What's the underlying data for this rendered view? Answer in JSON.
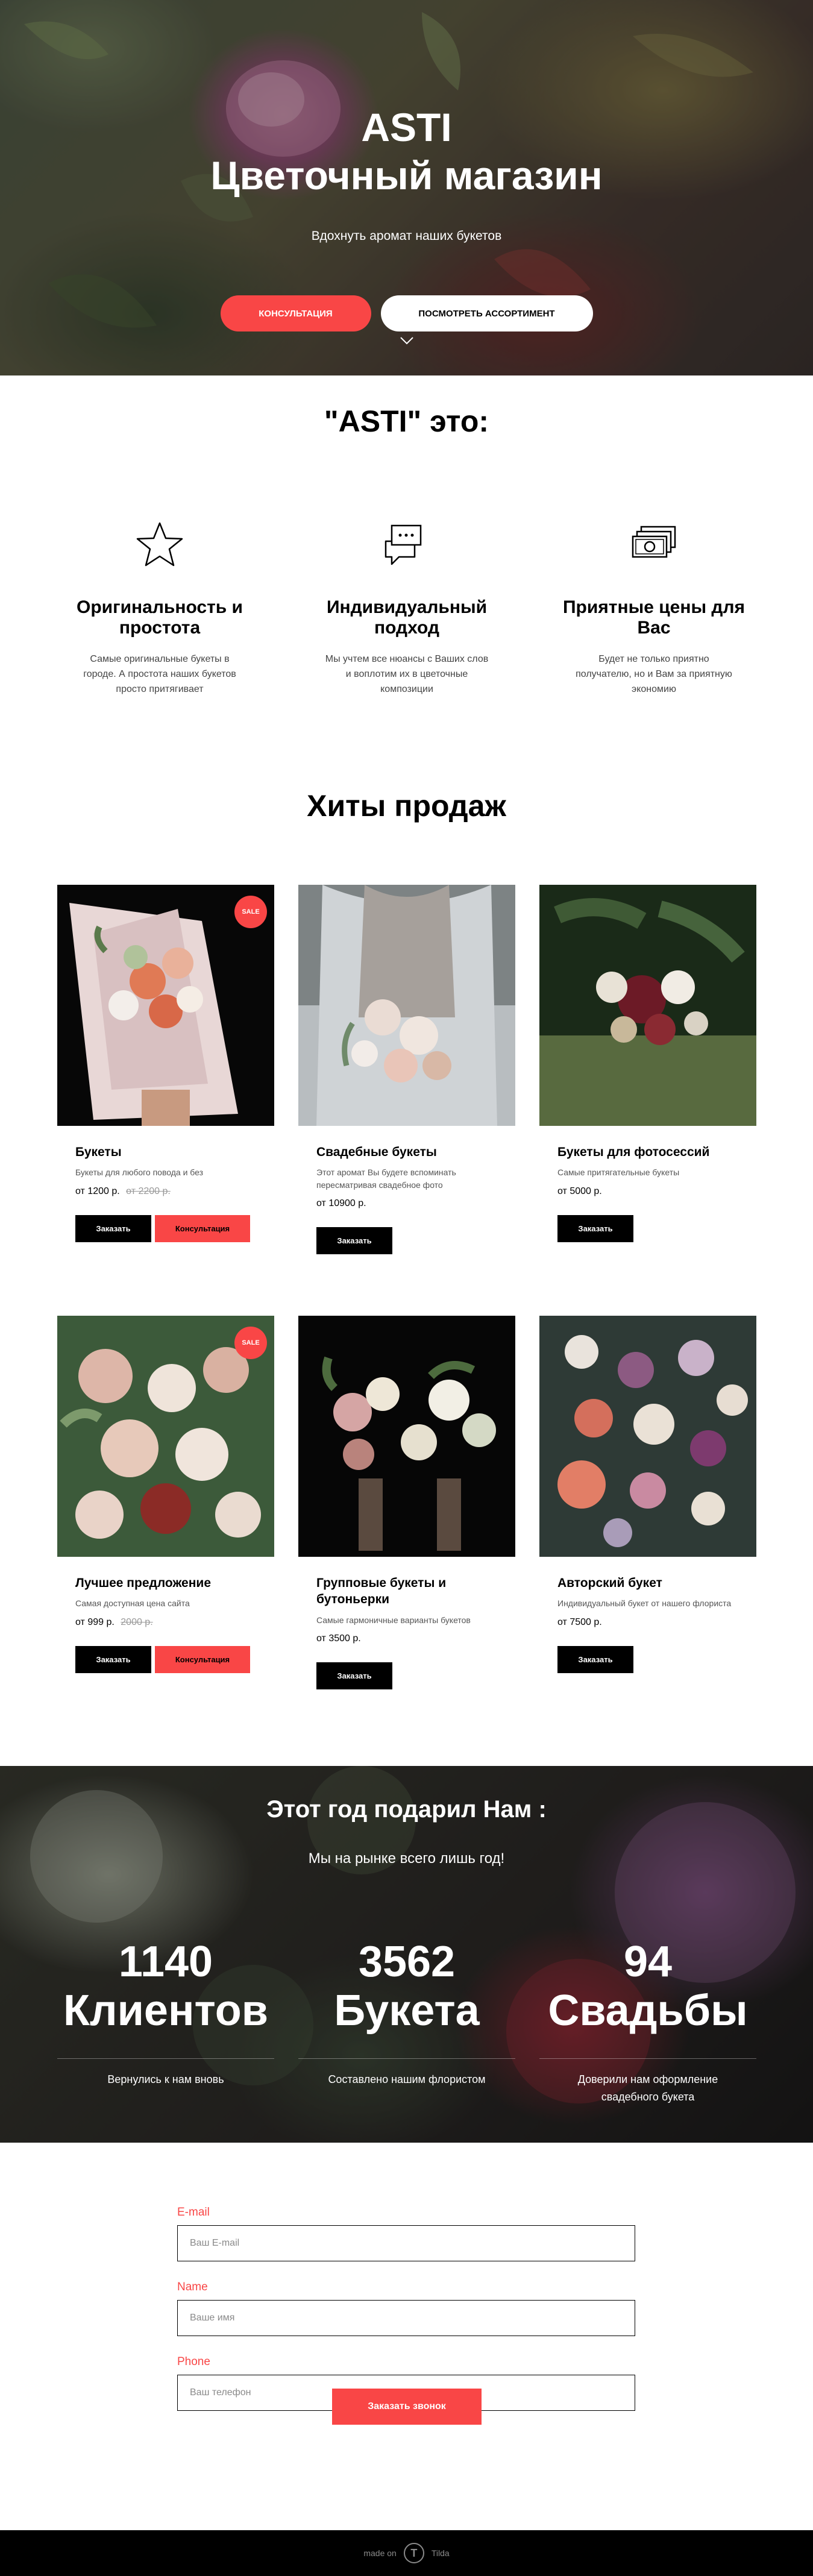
{
  "hero": {
    "title": "ASTI",
    "subtitle": "Цветочный магазин",
    "description": "Вдохнуть аромат наших букетов",
    "consult_button": "КОНСУЛЬТАЦИЯ",
    "catalog_button": "ПОСМОТРЕТЬ АССОРТИМЕНТ",
    "arrow_icon": "chevron-down-icon"
  },
  "about": {
    "title": "\"ASTI\" это:",
    "features": [
      {
        "icon": "star-icon",
        "title": "Оригинальность и простота",
        "text": "Самые оригинальные букеты в городе. А простота наших букетов просто притягивает"
      },
      {
        "icon": "chat-icon",
        "title": "Индивидуальный подход",
        "text": "Мы учтем все нюансы с Ваших слов и воплотим их в цветочные композиции"
      },
      {
        "icon": "money-icon",
        "title": "Приятные цены для Вас",
        "text": "Будет не только приятно получателю, но и Вам за приятную экономию"
      }
    ]
  },
  "products": {
    "title": "Хиты продаж",
    "sale_label": "SALE",
    "items": [
      {
        "title": "Букеты",
        "desc": "Букеты для любого повода и без",
        "price": "от 1200 р.",
        "old_price": "от 2200 р.",
        "sale": true,
        "order": "Заказать",
        "consult": "Консультация"
      },
      {
        "title": "Свадебные букеты",
        "desc": "Этот аромат Вы будете вспоминать пересматривая свадебное фото",
        "price": "от 10900 р.",
        "old_price": "",
        "sale": false,
        "order": "Заказать",
        "consult": ""
      },
      {
        "title": "Букеты для фотосессий",
        "desc": "Самые притягательные букеты",
        "price": "от 5000 р.",
        "old_price": "",
        "sale": false,
        "order": "Заказать",
        "consult": ""
      },
      {
        "title": "Лучшее предложение",
        "desc": "Самая доступная цена сайта",
        "price": "от 999 р.",
        "old_price": "2000 р.",
        "sale": true,
        "order": "Заказать",
        "consult": "Консультация"
      },
      {
        "title": "Групповые букеты и бутоньерки",
        "desc": "Самые гармоничные варианты букетов",
        "price": "от 3500 р.",
        "old_price": "",
        "sale": false,
        "order": "Заказать",
        "consult": ""
      },
      {
        "title": "Авторский букет",
        "desc": "Индивидуальный букет от нашего флориста",
        "price": "от 7500 р.",
        "old_price": "",
        "sale": false,
        "order": "Заказать",
        "consult": ""
      }
    ]
  },
  "stats": {
    "title": "Этот год подарил Нам :",
    "subtitle": "Мы на рынке всего лишь год!",
    "items": [
      {
        "number": "1140",
        "label": "Клиентов",
        "text": "Вернулись к нам вновь"
      },
      {
        "number": "3562",
        "label": "Букета",
        "text": "Составлено нашим флористом"
      },
      {
        "number": "94",
        "label": "Свадьбы",
        "text": "Доверили нам оформление свадебного букета"
      }
    ]
  },
  "form": {
    "email_label": "E-mail",
    "email_placeholder": "Ваш E-mail",
    "name_label": "Name",
    "name_placeholder": "Ваше имя",
    "phone_label": "Phone",
    "phone_placeholder": "Ваш телефон",
    "submit": "Заказать звонок"
  },
  "footer": {
    "made_on": "made on",
    "logo_letter": "T",
    "brand": "Tilda"
  },
  "colors": {
    "accent": "#f94646",
    "dark": "#000000",
    "text_muted": "#555555"
  }
}
